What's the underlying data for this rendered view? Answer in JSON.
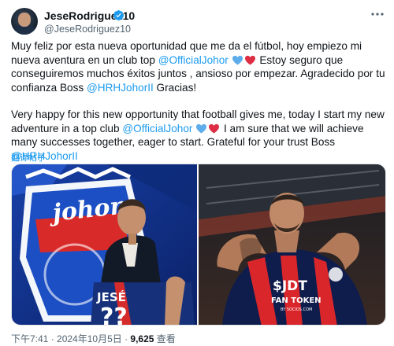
{
  "author": {
    "display_name": "JeseRodriguez10",
    "handle": "@JeseRodriguez10",
    "verified_badge_color": "#1d9bf0",
    "avatar_icon": "avatar"
  },
  "tweet": {
    "spanish": {
      "part1": "Muy feliz por esta nueva oportunidad que me da el fútbol, hoy empiezo mi nueva aventura en un club top ",
      "mention1": "@OfficialJohor",
      "part2": " Estoy seguro que conseguiremos muchos éxitos juntos , ansioso por empezar. Agradecido por tu confianza Boss ",
      "mention2": "@HRHJohorII",
      "part3": " Gracias!"
    },
    "english": {
      "part1": "Very happy for this new opportunity that football gives me, today I start my new adventure in a top club ",
      "mention1": "@OfficialJohor",
      "part2": " I am sure that we will achieve many successes together, eager to start. Grateful for your trust Boss ",
      "mention2": "@HRHJohorII"
    },
    "emojis": [
      "blue-heart-emoji",
      "red-heart-emoji"
    ],
    "mention_color": "#1d9bf0"
  },
  "translate_link": "翻译帖子",
  "media": {
    "left_photo": {
      "shirt_name": "JESÉ",
      "shirt_number": "??",
      "crest_text": "johor"
    },
    "right_photo": {
      "sponsor_main": "$JDT",
      "sponsor_sub": "FAN TOKEN",
      "sponsor_small": "BY SOCIOS.COM"
    }
  },
  "footer": {
    "time": "下午7:41",
    "separator": " · ",
    "date": "2024年10月5日",
    "views_count": "9,625",
    "views_label": "查看"
  }
}
